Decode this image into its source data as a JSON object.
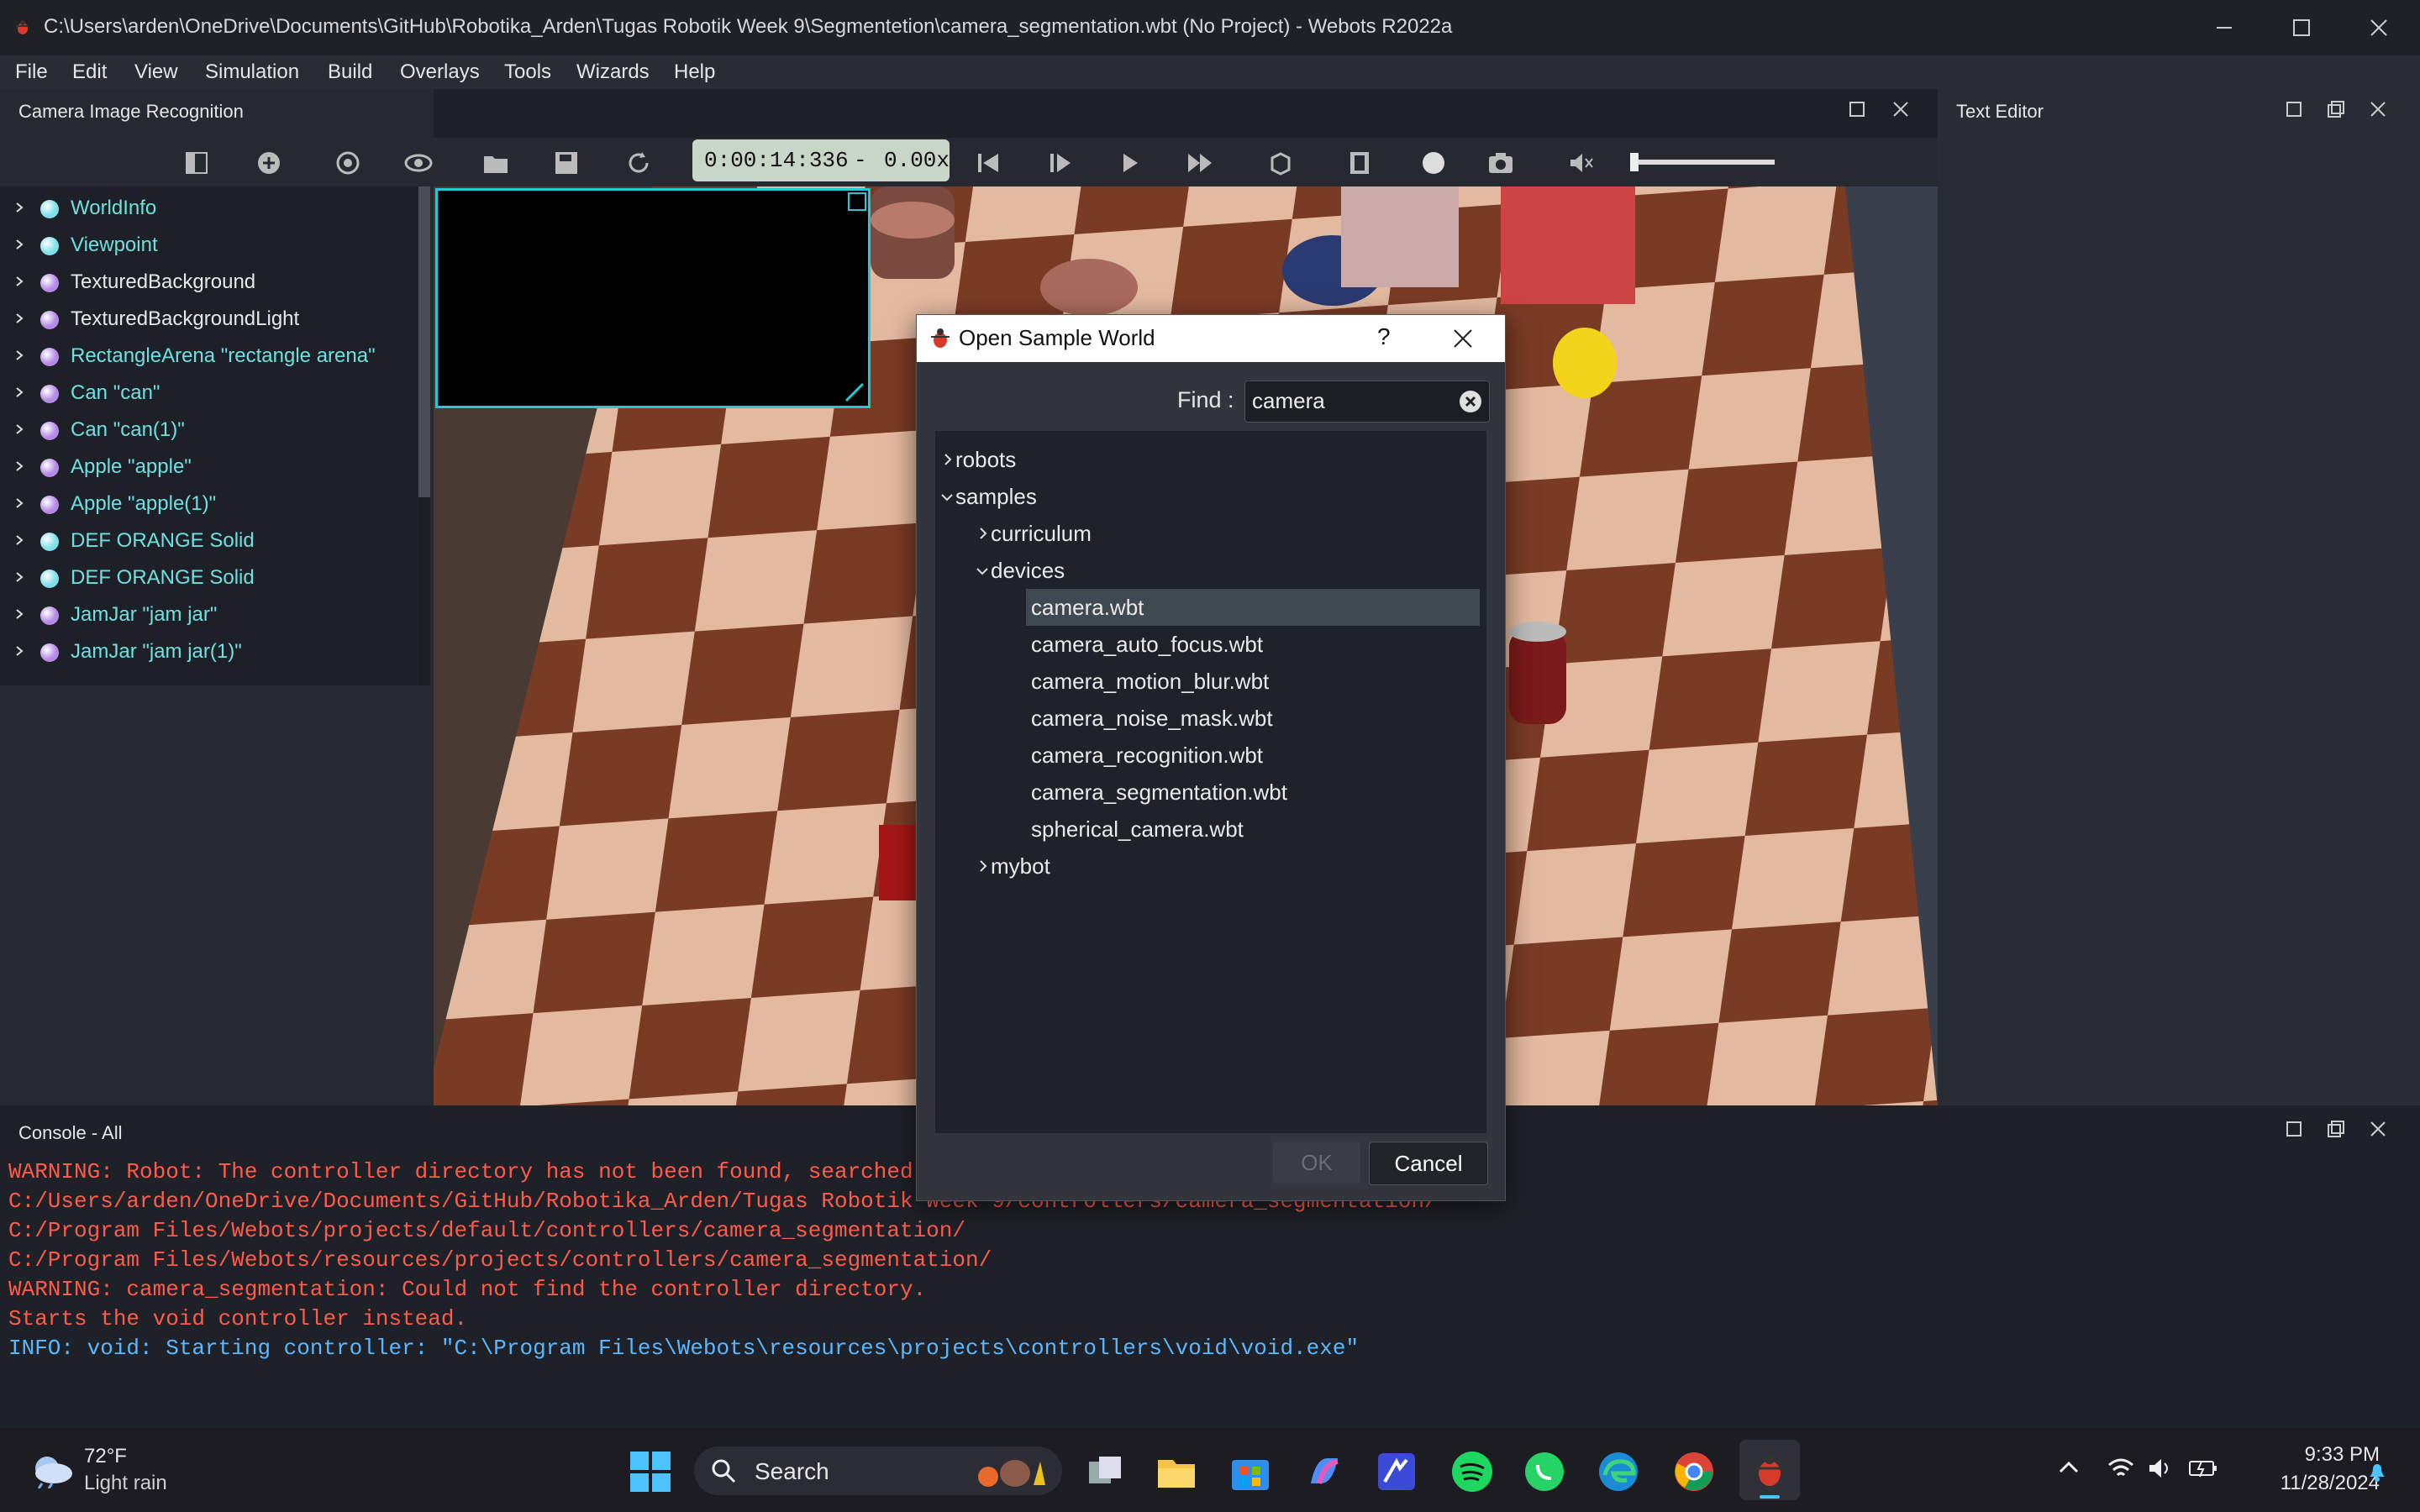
{
  "window": {
    "title": "C:\\Users\\arden\\OneDrive\\Documents\\GitHub\\Robotika_Arden\\Tugas Robotik Week 9\\Segmentetion\\camera_segmentation.wbt (No Project) - Webots R2022a"
  },
  "menu": [
    "File",
    "Edit",
    "View",
    "Simulation",
    "Build",
    "Overlays",
    "Tools",
    "Wizards",
    "Help"
  ],
  "left_panel": {
    "title": "Camera Image Recognition"
  },
  "toolbar": {
    "time": "0:00:14:336",
    "separator": "-",
    "speed": "0.00x"
  },
  "scene_tree": [
    {
      "label": "WorldInfo",
      "color": "#6fe0e0",
      "dot": "#7fe0e8"
    },
    {
      "label": "Viewpoint",
      "color": "#6fe0e0",
      "dot": "#7fe0e8"
    },
    {
      "label": "TexturedBackground",
      "color": "#e8e8e8",
      "dot": "#b58ae8"
    },
    {
      "label": "TexturedBackgroundLight",
      "color": "#e8e8e8",
      "dot": "#b58ae8"
    },
    {
      "label": "RectangleArena \"rectangle arena\"",
      "color": "#6fe0e0",
      "dot": "#b58ae8"
    },
    {
      "label": "Can \"can\"",
      "color": "#6fe0e0",
      "dot": "#b58ae8"
    },
    {
      "label": "Can \"can(1)\"",
      "color": "#6fe0e0",
      "dot": "#b58ae8"
    },
    {
      "label": "Apple \"apple\"",
      "color": "#6fe0e0",
      "dot": "#b58ae8"
    },
    {
      "label": "Apple \"apple(1)\"",
      "color": "#6fe0e0",
      "dot": "#b58ae8"
    },
    {
      "label": "DEF ORANGE Solid",
      "color": "#6fe0e0",
      "dot": "#7fe0e8"
    },
    {
      "label": "DEF ORANGE Solid",
      "color": "#6fe0e0",
      "dot": "#7fe0e8"
    },
    {
      "label": "JamJar \"jam jar\"",
      "color": "#6fe0e0",
      "dot": "#b58ae8"
    },
    {
      "label": "JamJar \"jam jar(1)\"",
      "color": "#6fe0e0",
      "dot": "#b58ae8"
    }
  ],
  "text_editor": {
    "title": "Text Editor"
  },
  "console": {
    "title": "Console - All",
    "lines": [
      {
        "text": "WARNING: Robot: The controller directory has not been found, searched the fo",
        "color": "#ff5b4a"
      },
      {
        "text": "C:/Users/arden/OneDrive/Documents/GitHub/Robotika_Arden/Tugas Robotik Week 9/controllers/camera_segmentation/",
        "color": "#ff5b4a"
      },
      {
        "text": "C:/Program Files/Webots/projects/default/controllers/camera_segmentation/",
        "color": "#ff5b4a"
      },
      {
        "text": "C:/Program Files/Webots/resources/projects/controllers/camera_segmentation/",
        "color": "#ff5b4a"
      },
      {
        "text": "WARNING: camera_segmentation: Could not find the controller directory.",
        "color": "#ff5b4a"
      },
      {
        "text": "Starts the void controller instead.",
        "color": "#ff5b4a"
      },
      {
        "text": "INFO: void: Starting controller: \"C:\\Program Files\\Webots\\resources\\projects\\controllers\\void\\void.exe\"",
        "color": "#5ab8ff"
      }
    ]
  },
  "dialog": {
    "title": "Open Sample World",
    "help": "?",
    "find_label": "Find :",
    "find_value": "camera",
    "tree": [
      {
        "label": "robots",
        "level": 0,
        "chevron": "right"
      },
      {
        "label": "samples",
        "level": 0,
        "chevron": "down"
      },
      {
        "label": "curriculum",
        "level": 1,
        "chevron": "right"
      },
      {
        "label": "devices",
        "level": 1,
        "chevron": "down"
      },
      {
        "label": "camera.wbt",
        "level": 2,
        "chevron": "none",
        "selected": true
      },
      {
        "label": "camera_auto_focus.wbt",
        "level": 2,
        "chevron": "none"
      },
      {
        "label": "camera_motion_blur.wbt",
        "level": 2,
        "chevron": "none"
      },
      {
        "label": "camera_noise_mask.wbt",
        "level": 2,
        "chevron": "none"
      },
      {
        "label": "camera_recognition.wbt",
        "level": 2,
        "chevron": "none"
      },
      {
        "label": "camera_segmentation.wbt",
        "level": 2,
        "chevron": "none"
      },
      {
        "label": "spherical_camera.wbt",
        "level": 2,
        "chevron": "none"
      },
      {
        "label": "mybot",
        "level": 1,
        "chevron": "right"
      }
    ],
    "ok_label": "OK",
    "cancel_label": "Cancel"
  },
  "taskbar": {
    "weather_temp": "72°F",
    "weather_desc": "Light rain",
    "search_label": "Search",
    "time": "9:33 PM",
    "date": "11/28/2024"
  }
}
